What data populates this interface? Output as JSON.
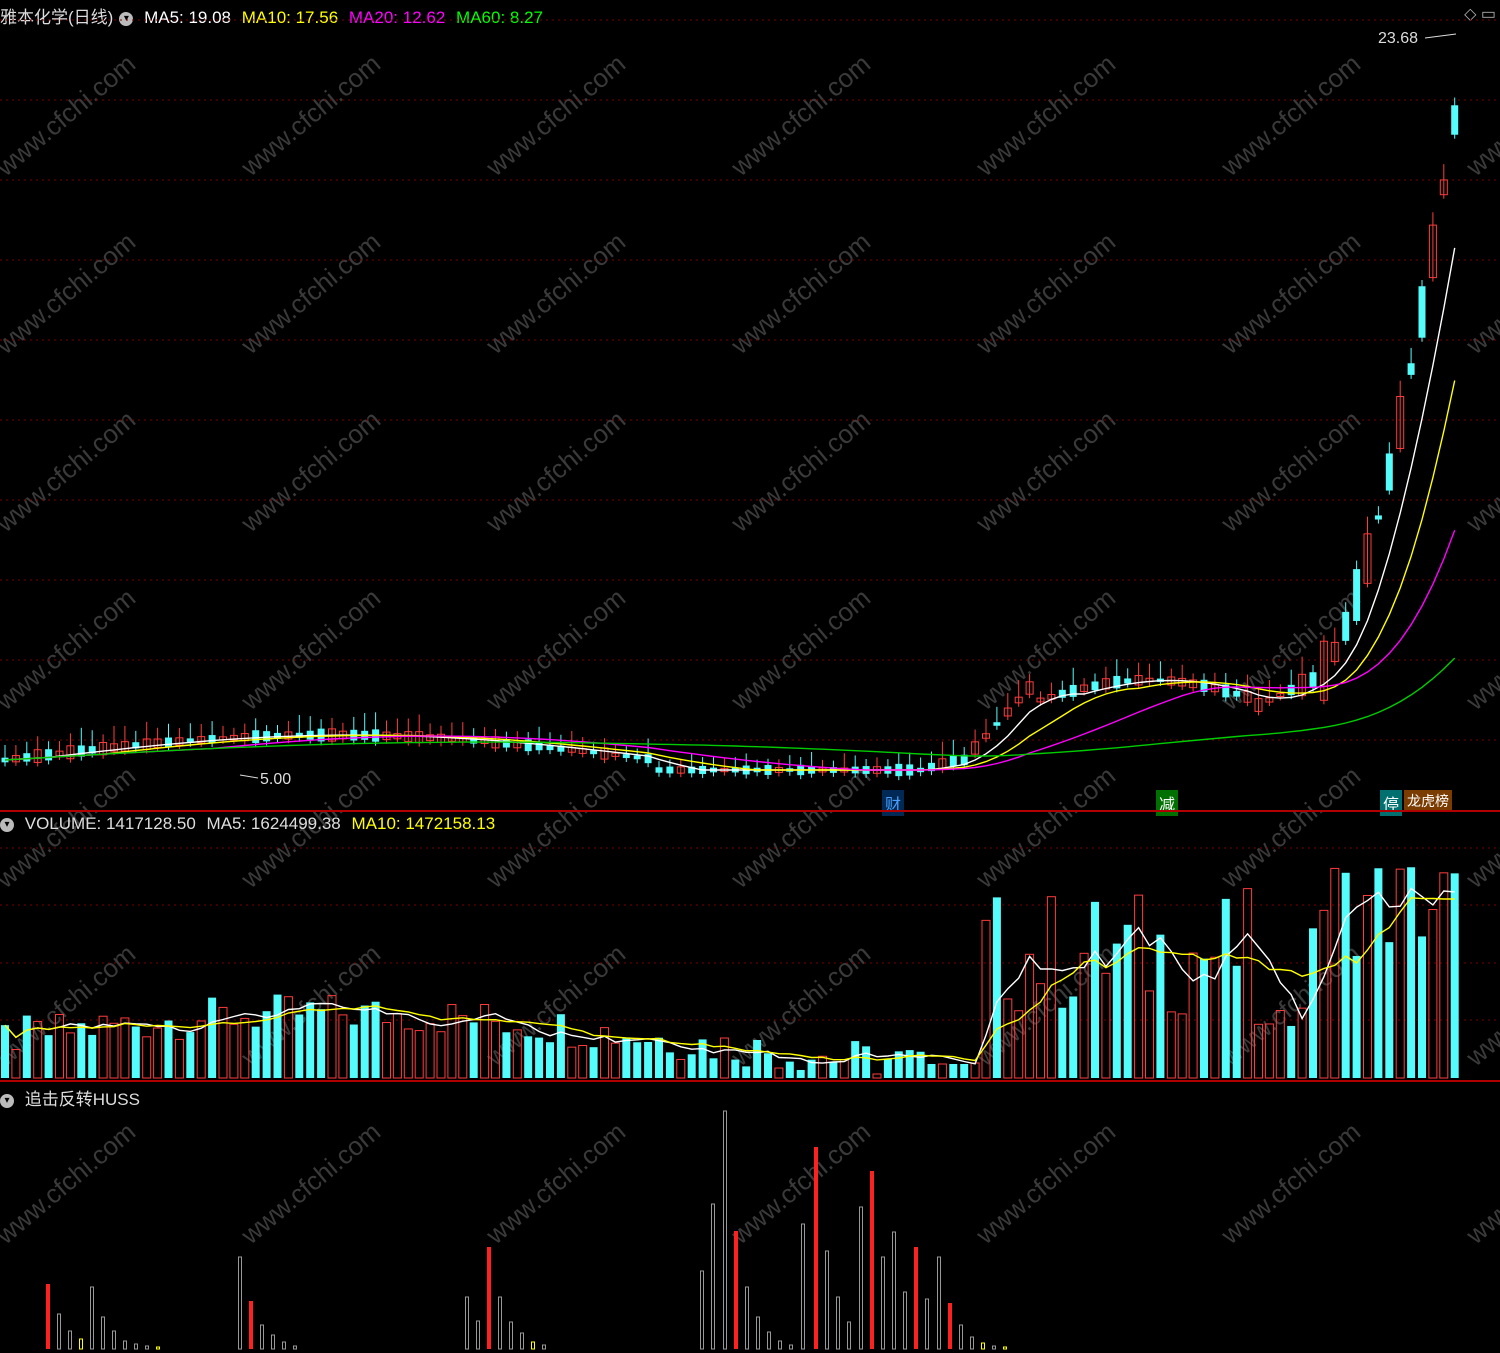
{
  "header": {
    "stock_name": "雅本化学(日线)",
    "ma5": "MA5: 19.08",
    "ma10": "MA10: 17.56",
    "ma20": "MA20: 12.62",
    "ma60": "MA60: 8.27"
  },
  "price_panel": {
    "high_label": "23.68",
    "low_label": "5.00",
    "markers": [
      {
        "text": "财",
        "color": "#4aa0ff",
        "bg": "#003366"
      },
      {
        "text": "减",
        "color": "#ffffff",
        "bg": "#007700"
      },
      {
        "text": "停",
        "color": "#ffffff",
        "bg": "#007777"
      },
      {
        "text": "龙虎榜",
        "color": "#ffffff",
        "bg": "#884400"
      }
    ]
  },
  "volume_panel": {
    "volume": "VOLUME: 1417128.50",
    "ma5": "MA5: 1624499.38",
    "ma10": "MA10: 1472158.13"
  },
  "indicator_panel": {
    "name": "追击反转HUSS"
  },
  "watermark": "www.cfchi.com",
  "colors": {
    "up": "#ff3c3c",
    "down": "#54fcfc",
    "ma5": "#ffffff",
    "ma10": "#ffff00",
    "ma20": "#ff00ff",
    "ma60": "#00cc00",
    "grid": "#7a0000"
  },
  "window_buttons": [
    "◇",
    "▭"
  ]
}
